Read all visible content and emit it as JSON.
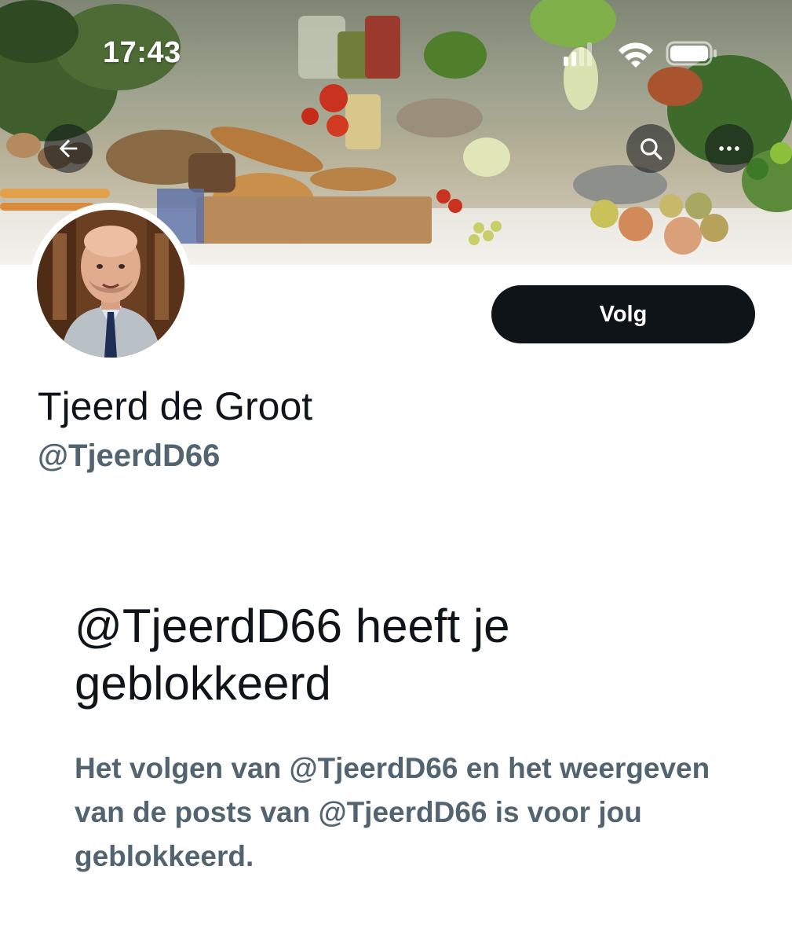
{
  "status_bar": {
    "time": "17:43",
    "icons": [
      "cellular-signal-icon",
      "wifi-icon",
      "battery-icon"
    ]
  },
  "banner": {
    "description_icons": [
      "back-arrow-icon",
      "search-icon",
      "more-icon"
    ]
  },
  "profile": {
    "display_name": "Tjeerd de Groot",
    "handle": "@TjeerdD66",
    "follow_label": "Volg"
  },
  "blocked": {
    "title": "@TjeerdD66 heeft je geblokkeerd",
    "description": "Het volgen van @TjeerdD66 en het weergeven van de posts van @TjeerdD66 is voor jou geblokkeerd."
  },
  "colors": {
    "text_primary": "#0f1419",
    "text_secondary": "#536471",
    "button_bg": "#0f1419",
    "button_text": "#ffffff"
  }
}
